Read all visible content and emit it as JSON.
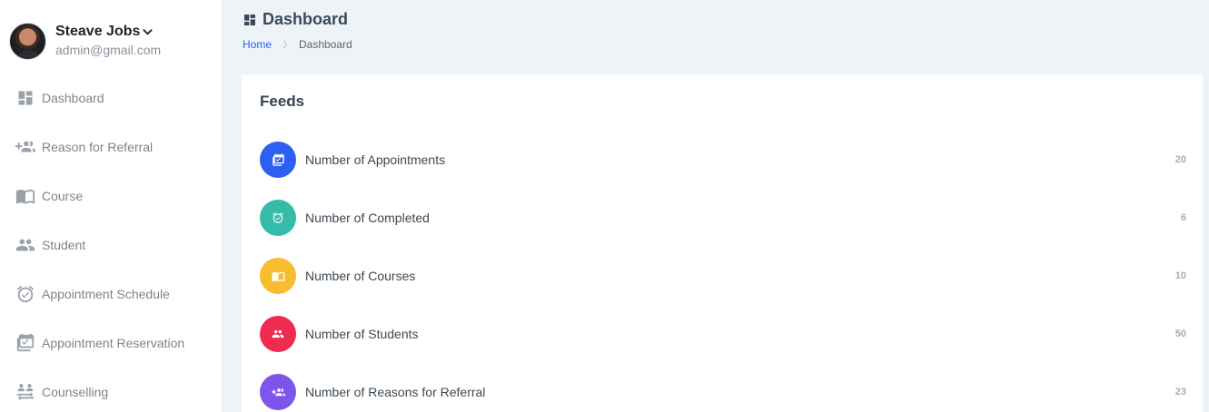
{
  "profile": {
    "name": "Steave Jobs",
    "email": "admin@gmail.com"
  },
  "sidebar": {
    "items": [
      {
        "label": "Dashboard",
        "icon": "dashboard-icon"
      },
      {
        "label": "Reason for Referral",
        "icon": "group-add-icon"
      },
      {
        "label": "Course",
        "icon": "book-icon"
      },
      {
        "label": "Student",
        "icon": "people-icon"
      },
      {
        "label": "Appointment Schedule",
        "icon": "alarm-check-icon"
      },
      {
        "label": "Appointment Reservation",
        "icon": "event-check-icon"
      },
      {
        "label": "Counselling",
        "icon": "swap-people-icon"
      }
    ]
  },
  "header": {
    "title": "Dashboard",
    "breadcrumb": {
      "home": "Home",
      "current": "Dashboard"
    }
  },
  "feeds": {
    "title": "Feeds",
    "items": [
      {
        "label": "Number of Appointments",
        "count": "20",
        "color": "#2d5ff0",
        "icon": "event-check-icon"
      },
      {
        "label": "Number of Completed",
        "count": "6",
        "color": "#34bca8",
        "icon": "alarm-check-icon"
      },
      {
        "label": "Number of Courses",
        "count": "10",
        "color": "#f8bd2e",
        "icon": "book-icon"
      },
      {
        "label": "Number of Students",
        "count": "50",
        "color": "#ef2b4f",
        "icon": "people-icon"
      },
      {
        "label": "Number of Reasons for Referral",
        "count": "23",
        "color": "#7d55ea",
        "icon": "group-add-icon"
      }
    ]
  }
}
